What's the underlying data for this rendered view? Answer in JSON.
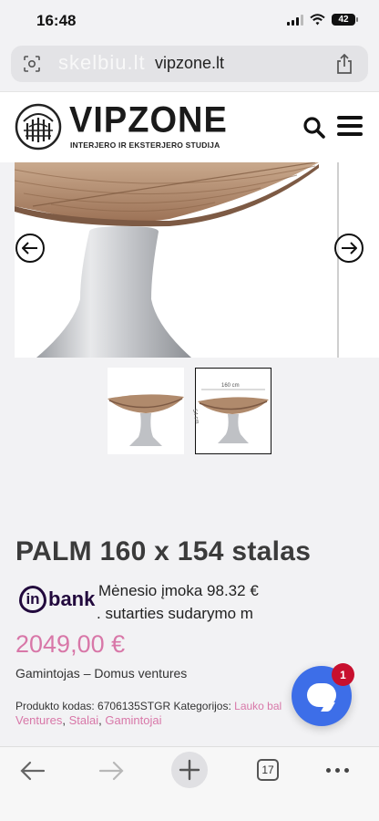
{
  "status": {
    "time": "16:48",
    "battery": "42"
  },
  "browser": {
    "url": "vipzone.lt",
    "watermark": "skelbiu.lt",
    "open_tabs": "17"
  },
  "site": {
    "logo_title": "VIPZONE",
    "logo_subtitle": "INTERJERO IR EKSTERJERO STUDIJA"
  },
  "gallery": {
    "dimension_width": "160 cm",
    "dimension_depth": "54 cm"
  },
  "product": {
    "title": "PALM 160 x 154 stalas",
    "financing_brand_in": "in",
    "financing_brand_bank": "bank",
    "monthly_line1": "Mėnesio įmoka 98.32 €",
    "monthly_line2": ". sutarties sudarymo m",
    "price": "2049,00 €",
    "manufacturer": "Gamintojas – Domus ventures",
    "meta_prefix": "Produkto kodas: 6706135STGR Kategorijos:",
    "meta_cat1": "Lauko bal",
    "meta_cat1_tail": "s",
    "meta_cat2": "Ventures",
    "meta_sep1": ",",
    "meta_cat3": "Stalai",
    "meta_sep2": ",",
    "meta_cat4": "Gamintojai"
  },
  "chat": {
    "badge": "1"
  },
  "colors": {
    "accent_pink": "#d877a8",
    "chat_blue": "#3d6ee8",
    "badge_red": "#c8102e",
    "inbank_purple": "#22093d"
  },
  "icons": [
    "camera-search-icon",
    "share-icon",
    "search-icon",
    "menu-icon",
    "arrow-left-icon",
    "arrow-right-icon",
    "chat-icon",
    "back-icon",
    "forward-icon",
    "plus-icon",
    "tabs-icon",
    "more-icon"
  ]
}
